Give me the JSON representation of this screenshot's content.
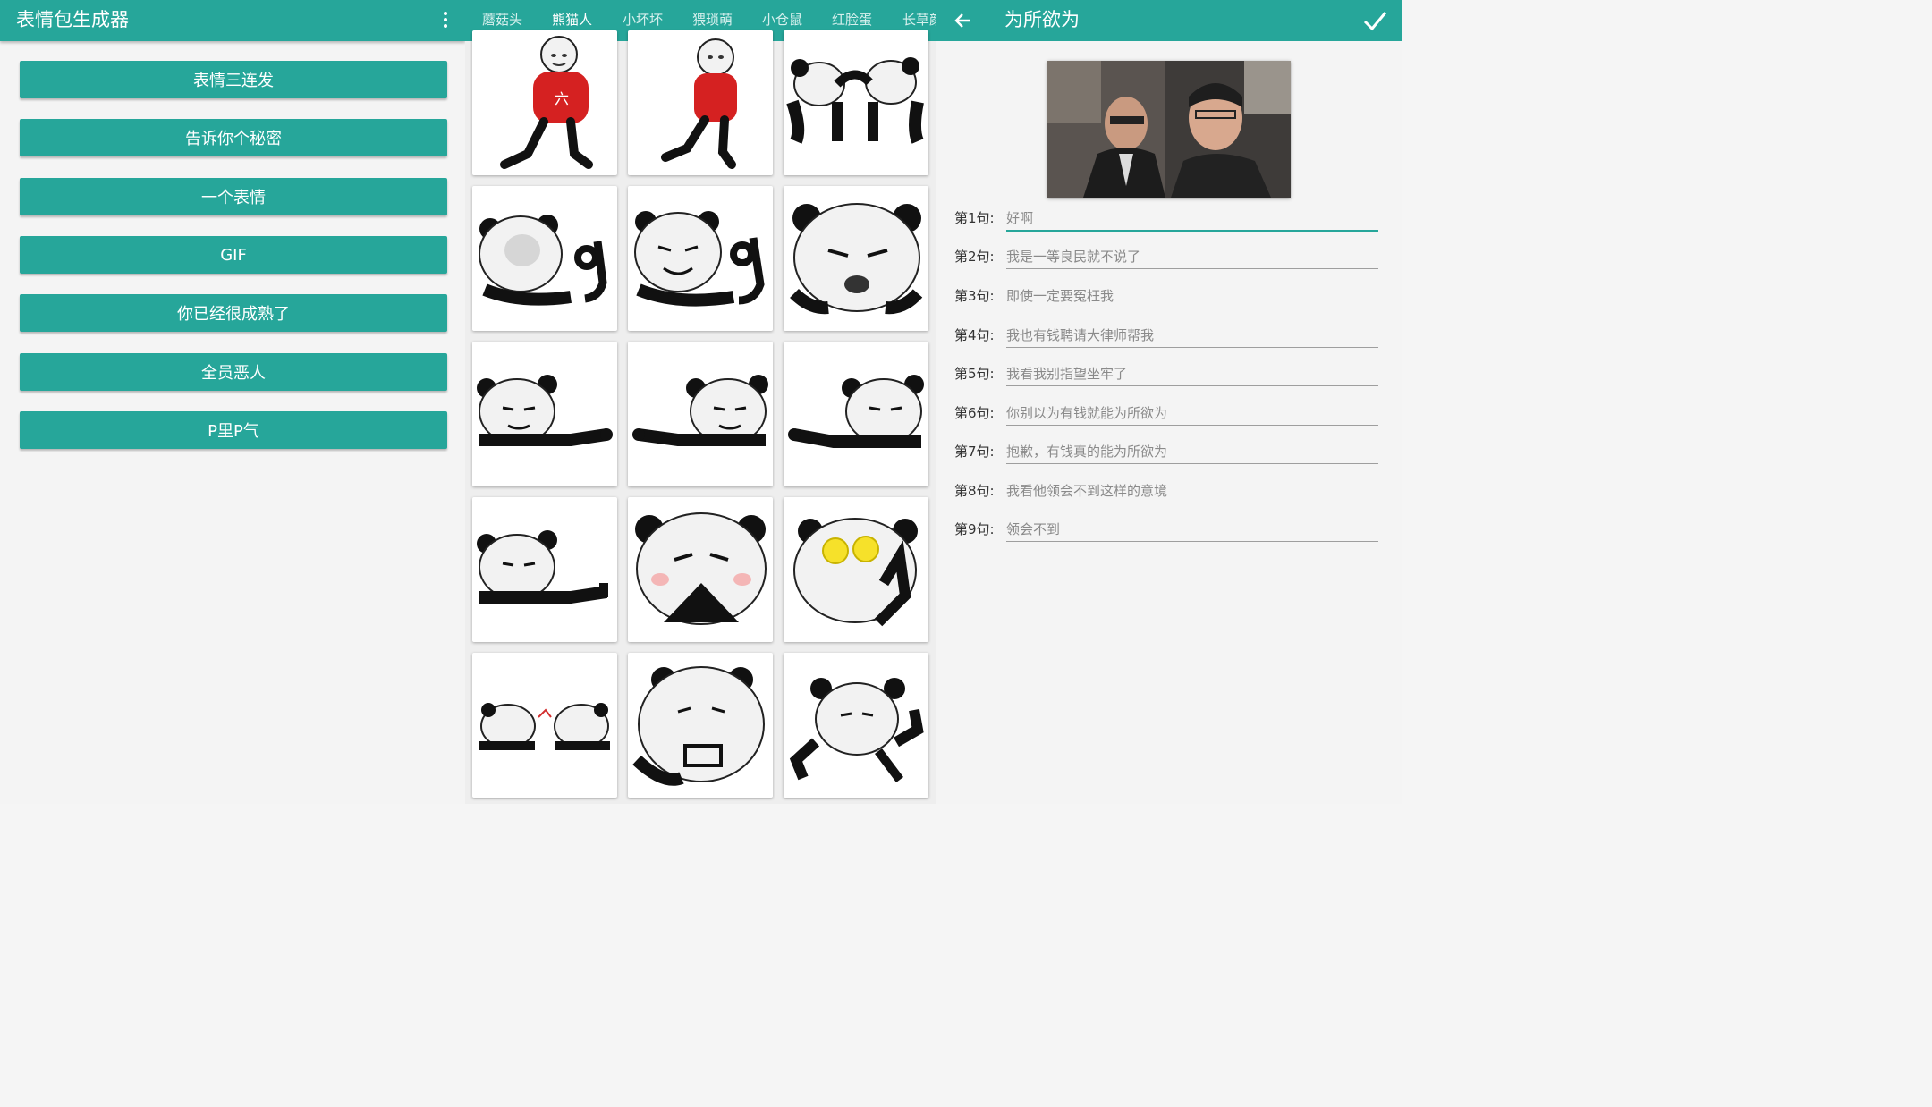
{
  "left_panel": {
    "title": "表情包生成器",
    "menu_items": [
      "表情三连发",
      "告诉你个秘密",
      "一个表情",
      "GIF",
      "你已经很成熟了",
      "全员恶人",
      "P里P气"
    ]
  },
  "middle_panel": {
    "tabs": [
      "蘑菇头",
      "熊猫人",
      "小坏坏",
      "猥琐萌",
      "小仓鼠",
      "红脸蛋",
      "长草颜"
    ],
    "active_tab": "熊猫人"
  },
  "right_panel": {
    "title": "为所欲为",
    "lines": [
      {
        "label": "第1句:",
        "value": "好啊"
      },
      {
        "label": "第2句:",
        "value": "我是一等良民就不说了"
      },
      {
        "label": "第3句:",
        "value": "即使一定要冤枉我"
      },
      {
        "label": "第4句:",
        "value": "我也有钱聘请大律师帮我"
      },
      {
        "label": "第5句:",
        "value": "我看我别指望坐牢了"
      },
      {
        "label": "第6句:",
        "value": "你别以为有钱就能为所欲为"
      },
      {
        "label": "第7句:",
        "value": "抱歉，有钱真的能为所欲为"
      },
      {
        "label": "第8句:",
        "value": "我看他领会不到这样的意境"
      },
      {
        "label": "第9句:",
        "value": "领会不到"
      }
    ]
  },
  "colors": {
    "accent": "#26a69a",
    "background": "#f4f4f4"
  },
  "icons": {
    "menu": "more-vert-icon",
    "back": "arrow-back-icon",
    "confirm": "check-icon"
  }
}
